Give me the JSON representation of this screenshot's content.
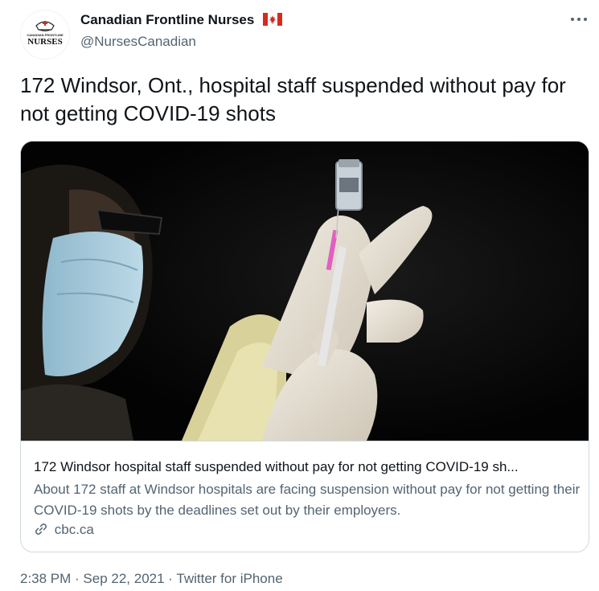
{
  "author": {
    "display_name": "Canadian Frontline Nurses",
    "handle": "@NursesCanadian",
    "avatar_text_top": "CANADIAN FRONTLINE",
    "avatar_text_main": "NURSES",
    "flag_icon": "canada-flag-icon"
  },
  "tweet": {
    "text": "172 Windsor, Ont., hospital staff suspended without pay for not getting COVID-19 shots"
  },
  "card": {
    "image_icon": "nurse-vaccine-syringe-photo",
    "title": "172 Windsor hospital staff suspended without pay for not getting COVID-19 sh...",
    "description": "About 172 staff at Windsor hospitals are facing suspension without pay for not getting their COVID-19 shots by the deadlines set out by their employers.",
    "domain": "cbc.ca",
    "link_icon": "link-icon"
  },
  "meta": {
    "time": "2:38 PM",
    "separator": " · ",
    "date": "Sep 22, 2021",
    "source": "Twitter for iPhone"
  },
  "colors": {
    "text_primary": "#0f1419",
    "text_secondary": "#536471",
    "border": "#cfd9de",
    "flag_red": "#d52b1e"
  }
}
